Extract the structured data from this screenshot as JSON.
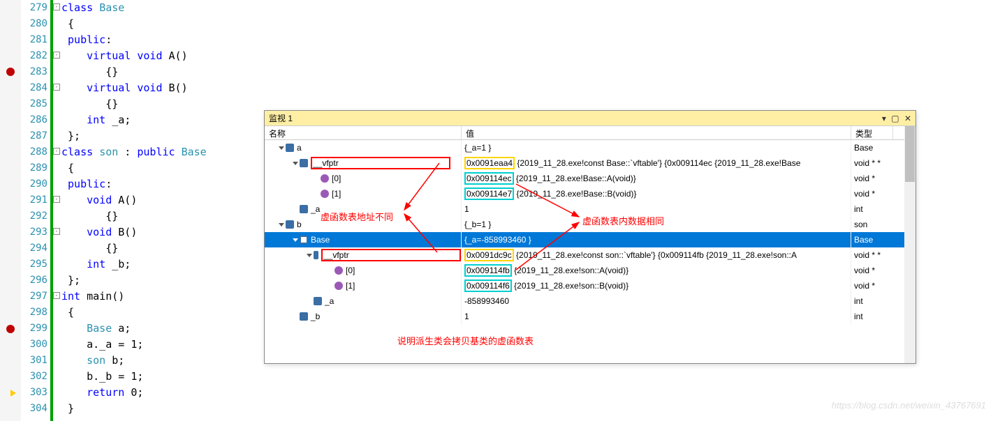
{
  "code": {
    "lines": [
      {
        "n": "279",
        "t": [
          {
            "kw": "class "
          },
          {
            "type": "Base"
          }
        ]
      },
      {
        "n": "280",
        "t": [
          {
            "p": " {"
          }
        ]
      },
      {
        "n": "281",
        "t": [
          {
            "p": " "
          },
          {
            "kw": "public"
          },
          {
            "p": ":"
          }
        ]
      },
      {
        "n": "282",
        "t": [
          {
            "p": "    "
          },
          {
            "kw": "virtual void"
          },
          {
            "p": " A()"
          }
        ]
      },
      {
        "n": "283",
        "t": [
          {
            "p": "       {}"
          }
        ]
      },
      {
        "n": "284",
        "t": [
          {
            "p": "    "
          },
          {
            "kw": "virtual void"
          },
          {
            "p": " B()"
          }
        ]
      },
      {
        "n": "285",
        "t": [
          {
            "p": "       {}"
          }
        ]
      },
      {
        "n": "286",
        "t": [
          {
            "p": "    "
          },
          {
            "kw": "int"
          },
          {
            "p": " _a;"
          }
        ]
      },
      {
        "n": "287",
        "t": [
          {
            "p": " };"
          }
        ]
      },
      {
        "n": "288",
        "t": [
          {
            "kw": "class "
          },
          {
            "type": "son"
          },
          {
            "p": " : "
          },
          {
            "kw": "public "
          },
          {
            "type": "Base"
          }
        ]
      },
      {
        "n": "289",
        "t": [
          {
            "p": " {"
          }
        ]
      },
      {
        "n": "290",
        "t": [
          {
            "p": " "
          },
          {
            "kw": "public"
          },
          {
            "p": ":"
          }
        ]
      },
      {
        "n": "291",
        "t": [
          {
            "p": "    "
          },
          {
            "kw": "void"
          },
          {
            "p": " A()"
          }
        ]
      },
      {
        "n": "292",
        "t": [
          {
            "p": "       {}"
          }
        ]
      },
      {
        "n": "293",
        "t": [
          {
            "p": "    "
          },
          {
            "kw": "void"
          },
          {
            "p": " B()"
          }
        ]
      },
      {
        "n": "294",
        "t": [
          {
            "p": "       {}"
          }
        ]
      },
      {
        "n": "295",
        "t": [
          {
            "p": "    "
          },
          {
            "kw": "int"
          },
          {
            "p": " _b;"
          }
        ]
      },
      {
        "n": "296",
        "t": [
          {
            "p": " };"
          }
        ]
      },
      {
        "n": "297",
        "t": [
          {
            "kw": "int"
          },
          {
            "p": " main()"
          }
        ]
      },
      {
        "n": "298",
        "t": [
          {
            "p": " {"
          }
        ]
      },
      {
        "n": "299",
        "t": [
          {
            "p": "    "
          },
          {
            "type": "Base"
          },
          {
            "p": " a;"
          }
        ]
      },
      {
        "n": "300",
        "t": [
          {
            "p": "    a._a = 1;"
          }
        ]
      },
      {
        "n": "301",
        "t": [
          {
            "p": "    "
          },
          {
            "type": "son"
          },
          {
            "p": " b;"
          }
        ]
      },
      {
        "n": "302",
        "t": [
          {
            "p": "    b._b = 1;"
          }
        ]
      },
      {
        "n": "303",
        "t": [
          {
            "p": "    "
          },
          {
            "kw": "return"
          },
          {
            "p": " 0;"
          }
        ]
      },
      {
        "n": "304",
        "t": [
          {
            "p": " }"
          }
        ]
      }
    ]
  },
  "watch": {
    "title": "监视 1",
    "headers": {
      "name": "名称",
      "value": "值",
      "type": "类型"
    },
    "rows": [
      {
        "indent": 20,
        "expand": 1,
        "icon": "var",
        "name": "a",
        "value": "{_a=1 }",
        "type": "Base"
      },
      {
        "indent": 40,
        "expand": 1,
        "icon": "var",
        "name": "__vfptr",
        "nameHL": "red",
        "valPre": "0x0091eaa4",
        "valPreHL": "yellow",
        "valRest": " {2019_11_28.exe!const Base::`vftable'} {0x009114ec {2019_11_28.exe!Base",
        "type": "void * *"
      },
      {
        "indent": 70,
        "expand": 0,
        "icon": "class",
        "name": "[0]",
        "valPre": "0x009114ec",
        "valPreHL": "cyan",
        "valRest": " {2019_11_28.exe!Base::A(void)}",
        "type": "void *"
      },
      {
        "indent": 70,
        "expand": 0,
        "icon": "class",
        "name": "[1]",
        "valPre": "0x009114e7",
        "valPreHL": "cyan",
        "valRest": " {2019_11_28.exe!Base::B(void)}",
        "type": "void *"
      },
      {
        "indent": 40,
        "expand": -1,
        "icon": "var",
        "name": "_a",
        "value": "1",
        "type": "int"
      },
      {
        "indent": 20,
        "expand": 1,
        "icon": "var",
        "name": "b",
        "value": "{_b=1 }",
        "type": "son"
      },
      {
        "indent": 40,
        "expand": 1,
        "icon": "struct",
        "name": "Base",
        "value": "{_a=-858993460 }",
        "type": "Base",
        "selected": true
      },
      {
        "indent": 60,
        "expand": 1,
        "icon": "var",
        "name": "__vfptr",
        "nameHL": "red",
        "valPre": "0x0091dc9c",
        "valPreHL": "yellow",
        "valRest": " {2019_11_28.exe!const son::`vftable'} {0x009114fb {2019_11_28.exe!son::A",
        "type": "void * *"
      },
      {
        "indent": 90,
        "expand": 0,
        "icon": "class",
        "name": "[0]",
        "valPre": "0x009114fb",
        "valPreHL": "cyan",
        "valRest": " {2019_11_28.exe!son::A(void)}",
        "type": "void *"
      },
      {
        "indent": 90,
        "expand": 0,
        "icon": "class",
        "name": "[1]",
        "valPre": "0x009114f6",
        "valPreHL": "cyan",
        "valRest": " {2019_11_28.exe!son::B(void)}",
        "type": "void *"
      },
      {
        "indent": 60,
        "expand": -1,
        "icon": "var",
        "name": "_a",
        "value": "-858993460",
        "type": "int"
      },
      {
        "indent": 40,
        "expand": -1,
        "icon": "var",
        "name": "_b",
        "value": "1",
        "type": "int"
      }
    ]
  },
  "annotations": {
    "a1": "虚函数表地址不同",
    "a2": "虚函数表内数据相同",
    "a3": "说明派生类会拷贝基类的虚函数表"
  },
  "watermark": "https://blog.csdn.net/weixin_43767691"
}
